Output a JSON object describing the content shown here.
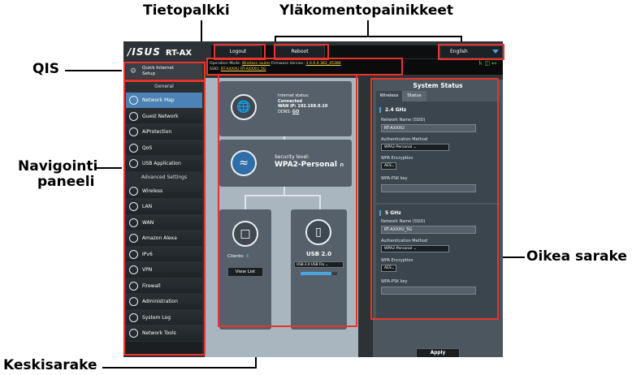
{
  "annotations": {
    "tietopalkki": "Tietopalkki",
    "ylakomentopainikkeet": "Yläkomentopainikkeet",
    "qis": "QIS",
    "navigointi_line1": "Navigointi",
    "navigointi_line2": "paneeli",
    "oikea_sarake": "Oikea sarake",
    "keskisarake": "Keskisarake"
  },
  "header": {
    "logo": "/ISUS",
    "model": "RT-AX",
    "logout": "Logout",
    "reboot": "Reboot",
    "language": "English"
  },
  "infobar": {
    "line1_label": "Operation Mode:",
    "line1_mode": "Wireless router",
    "line1_fw_label": "Firmware Version:",
    "line1_fw": "3.0.0.4.382_45386",
    "line2_label": "SSID:",
    "line2_ssid": "RT-AXXXU  RT-AXXXU_5G"
  },
  "qis": {
    "line1": "Quick Internet",
    "line2": "Setup"
  },
  "nav": {
    "general_header": "General",
    "general": [
      {
        "label": "Network Map",
        "icon": "network-map-icon"
      },
      {
        "label": "Guest Network",
        "icon": "guest-network-icon"
      },
      {
        "label": "AiProtection",
        "icon": "aiprotection-icon"
      },
      {
        "label": "QoS",
        "icon": "qos-icon"
      },
      {
        "label": "USB Application",
        "icon": "usb-application-icon"
      }
    ],
    "advanced_header": "Advanced Settings",
    "advanced": [
      {
        "label": "Wireless",
        "icon": "wireless-icon"
      },
      {
        "label": "LAN",
        "icon": "lan-icon"
      },
      {
        "label": "WAN",
        "icon": "wan-icon"
      },
      {
        "label": "Amazon Alexa",
        "icon": "amazon-alexa-icon"
      },
      {
        "label": "IPv6",
        "icon": "ipv6-icon"
      },
      {
        "label": "VPN",
        "icon": "vpn-icon"
      },
      {
        "label": "Firewall",
        "icon": "firewall-icon"
      },
      {
        "label": "Administration",
        "icon": "administration-icon"
      },
      {
        "label": "System Log",
        "icon": "system-log-icon"
      },
      {
        "label": "Network Tools",
        "icon": "network-tools-icon"
      }
    ]
  },
  "center": {
    "internet_status_label": "Internet status:",
    "internet_status": "Connected",
    "wan_ip": "WAN IP: 192.168.0.10",
    "ddns_label": "DDNS:",
    "ddns_value": "GO",
    "security_label": "Security level:",
    "security_value": "WPA2-Personal",
    "clients_label": "Clients:",
    "clients_count": "4",
    "view_list": "View List",
    "usb_title": "USB 2.0",
    "usb_select": "USB 2.0 USB Fla",
    "usb_usage": 0.85
  },
  "right": {
    "title": "System Status",
    "tab_wireless": "Wireless",
    "tab_status": "Status",
    "band1": {
      "name": "2.4 GHz",
      "ssid_label": "Network Name (SSID)",
      "ssid": "RT-AXXXU",
      "auth_label": "Authentication Method",
      "auth": "WPA2-Personal",
      "enc_label": "WPA Encryption",
      "enc": "AES",
      "psk_label": "WPA-PSK key",
      "psk": ""
    },
    "band2": {
      "name": "5 GHz",
      "ssid_label": "Network Name (SSID)",
      "ssid": "RT-AXXXU_5G",
      "auth_label": "Authentication Method",
      "auth": "WPA2-Personal",
      "enc_label": "WPA Encryption",
      "enc": "AES",
      "psk_label": "WPA-PSK key",
      "psk": ""
    },
    "apply": "Apply"
  },
  "colors": {
    "highlight": "#e8342a",
    "accent": "#4aa3e0",
    "active_nav": "#4c82b5"
  }
}
